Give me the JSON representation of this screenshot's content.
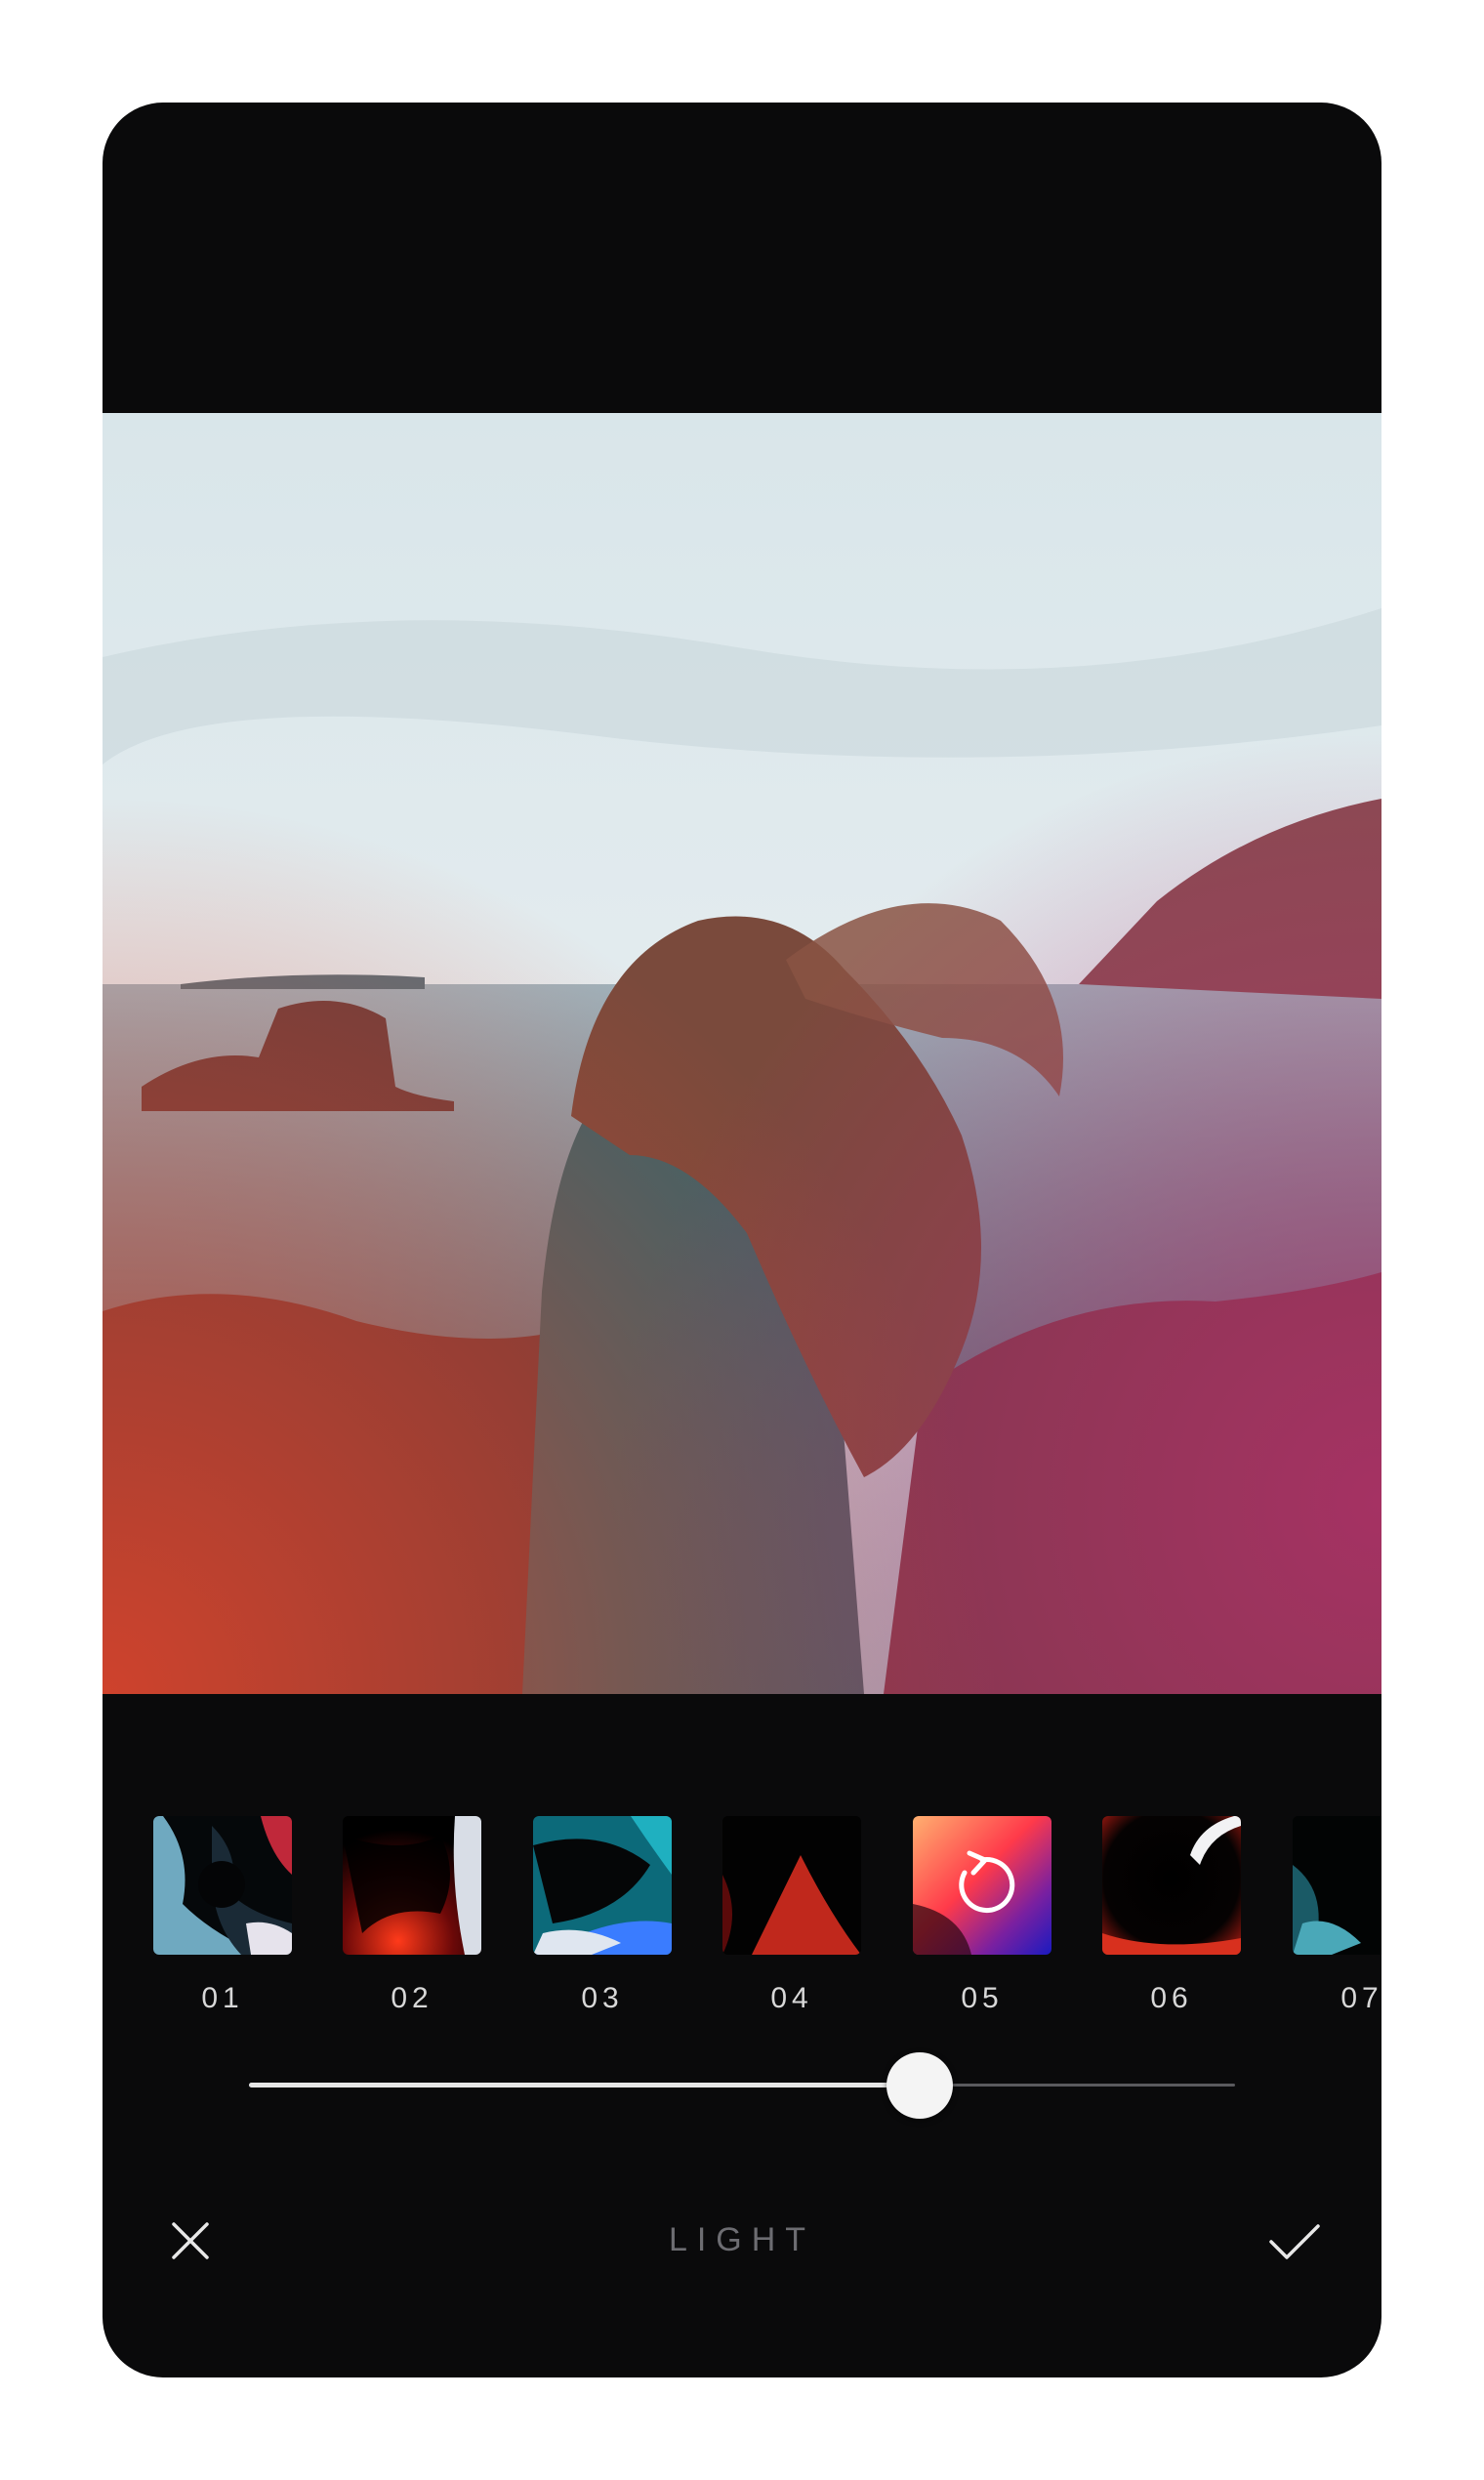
{
  "tool": {
    "title": "LIGHT"
  },
  "filters": [
    {
      "label": "01",
      "selected": false
    },
    {
      "label": "02",
      "selected": false
    },
    {
      "label": "03",
      "selected": false
    },
    {
      "label": "04",
      "selected": false
    },
    {
      "label": "05",
      "selected": true
    },
    {
      "label": "06",
      "selected": false
    },
    {
      "label": "07",
      "selected": false
    }
  ],
  "slider": {
    "value": 0.68
  },
  "icons": {
    "cancel": "close-icon",
    "confirm": "check-icon",
    "reset": "reset-icon"
  },
  "colors": {
    "background": "#0a0a0b",
    "label": "#d8d8d8",
    "title": "#6d6d72",
    "slider_fill": "#e6e6e6",
    "slider_track": "#5a5a5e"
  }
}
